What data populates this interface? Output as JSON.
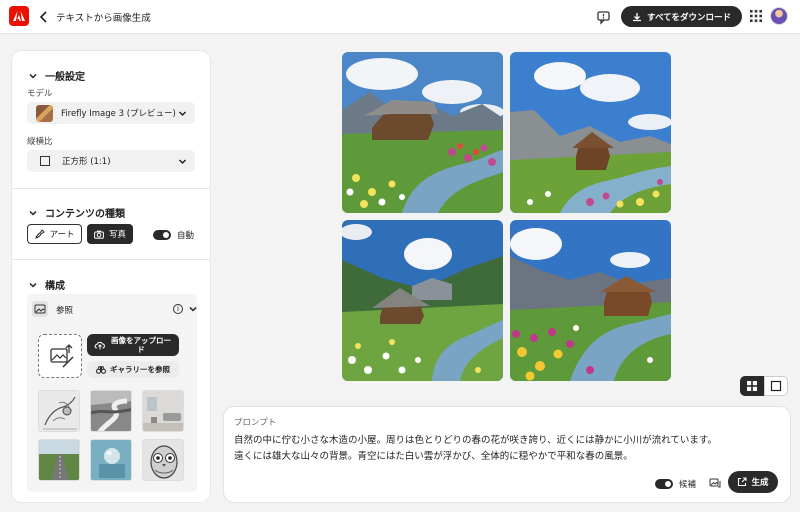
{
  "header": {
    "title": "テキストから画像生成",
    "download_all_label": "すべてをダウンロード"
  },
  "sidebar": {
    "general": {
      "title": "一般設定",
      "model_label": "モデル",
      "model_value": "Firefly Image 3 (プレビュー)",
      "aspect_label": "縦横比",
      "aspect_value": "正方形 (1:1)"
    },
    "content_type": {
      "title": "コンテンツの種類",
      "art_label": "アート",
      "photo_label": "写真",
      "auto_label": "自動",
      "selected": "photo",
      "auto_enabled": true
    },
    "composition": {
      "title": "構成",
      "reference_label": "参照",
      "upload_label": "画像をアップロード",
      "gallery_label": "ギャラリーを参照",
      "thumbnails": [
        "sketch-bird",
        "curved-road",
        "living-room",
        "straight-road",
        "sphere-cubes",
        "owl-sketch"
      ]
    }
  },
  "images": [
    "cabin-meadow-1",
    "cabin-meadow-2",
    "cabin-meadow-3",
    "cabin-meadow-4"
  ],
  "view_mode": "grid",
  "prompt": {
    "label": "プロンプト",
    "line1": "自然の中に佇む小さな木造の小屋。周りは色とりどりの春の花が咲き誇り、近くには静かに小川が流れています。",
    "line2": "遠くには雄大な山々の背景。青空にはた白い雲が浮かび、全体的に穏やかで平和な春の風景。",
    "candidates_label": "候補",
    "candidates_enabled": true,
    "generate_label": "生成"
  },
  "colors": {
    "brand": "#eb1000",
    "dark": "#2a2a2a",
    "panel": "#ffffff",
    "background": "#f3f3f3"
  }
}
